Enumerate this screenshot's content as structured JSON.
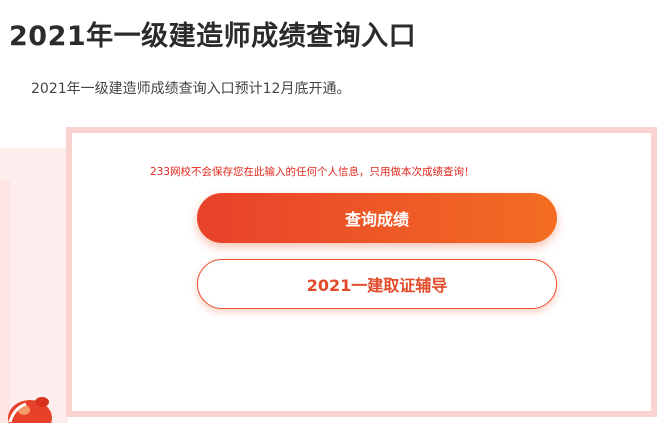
{
  "header": {
    "title": "2021年一级建造师成绩查询入口"
  },
  "intro": {
    "text": "2021年一级建造师成绩查询入口预计12月底开通。"
  },
  "query_card": {
    "notice": "233网校不会保存您在此输入的任何个人信息，只用做本次成绩查询！",
    "primary_button_label": "查询成绩",
    "secondary_button_label": "2021一建取证辅导"
  },
  "colors": {
    "accent": "#e8412b",
    "accent_end": "#f36d22",
    "card_border": "#f9d3d0",
    "notice_text": "#e0281d"
  },
  "icons": {
    "mascot": "mascot-icon"
  }
}
